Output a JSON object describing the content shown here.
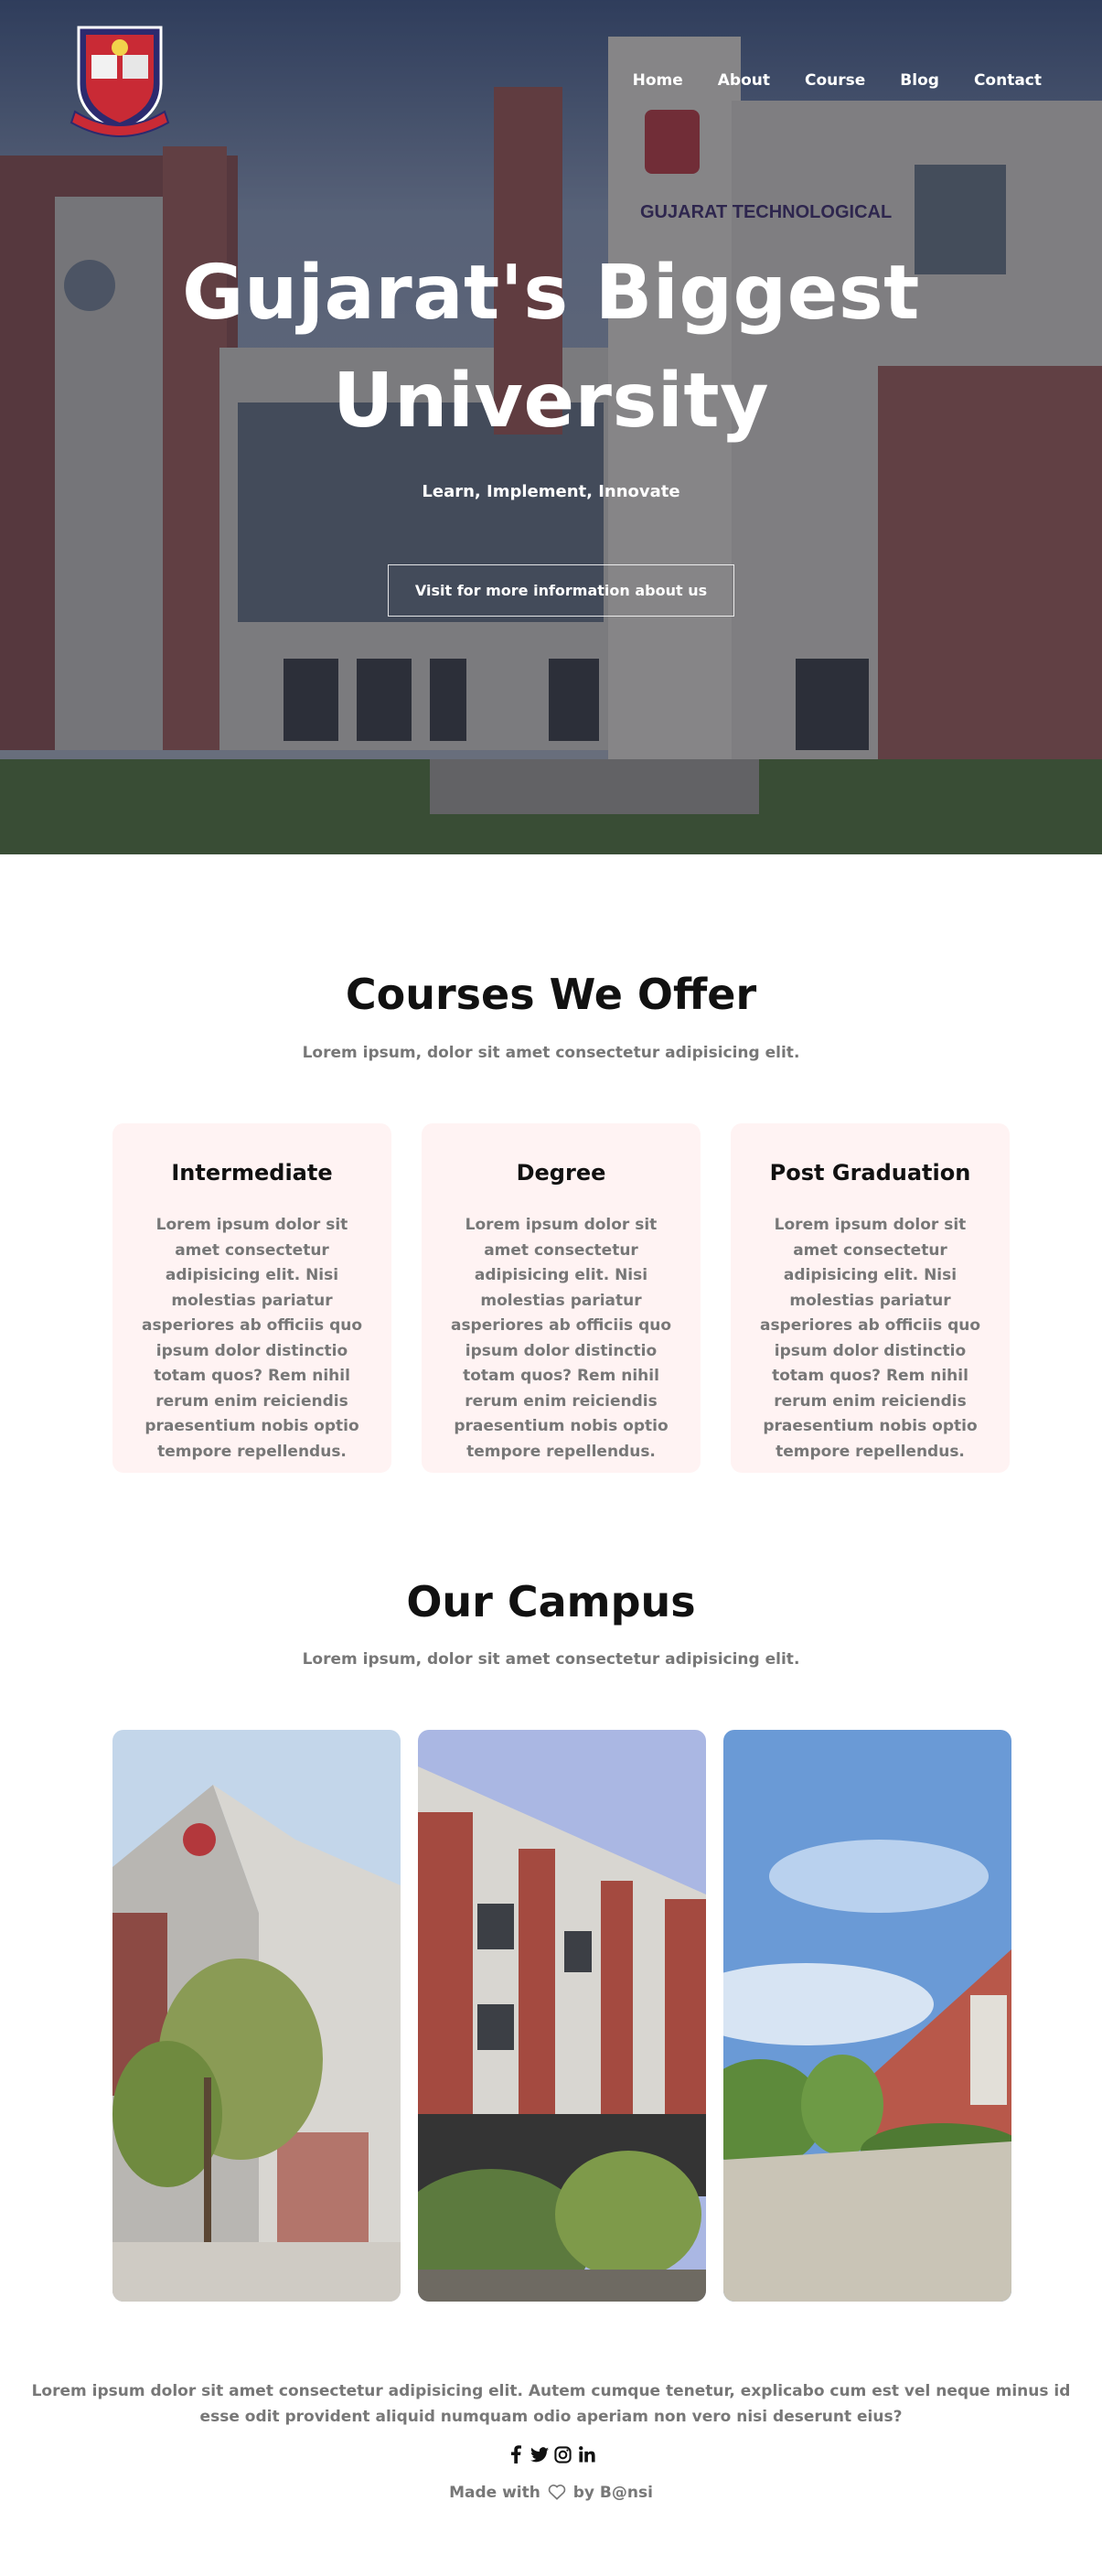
{
  "nav": {
    "items": [
      "Home",
      "About",
      "Course",
      "Blog",
      "Contact"
    ]
  },
  "hero": {
    "title_line1": "Gujarat's Biggest",
    "title_line2": "University",
    "subtitle": "Learn, Implement, Innovate",
    "button_label": "Visit for more information about us",
    "building_sign": "GUJARAT TECHNOLOGICAL"
  },
  "courses": {
    "title": "Courses We Offer",
    "subtitle": "Lorem ipsum, dolor sit amet consectetur adipisicing elit.",
    "cards": [
      {
        "title": "Intermediate",
        "body": "Lorem ipsum dolor sit amet consectetur adipisicing elit. Nisi molestias pariatur asperiores ab officiis quo ipsum dolor distinctio totam quos? Rem nihil rerum enim reiciendis praesentium nobis optio tempore repellendus."
      },
      {
        "title": "Degree",
        "body": "Lorem ipsum dolor sit amet consectetur adipisicing elit. Nisi molestias pariatur asperiores ab officiis quo ipsum dolor distinctio totam quos? Rem nihil rerum enim reiciendis praesentium nobis optio tempore repellendus."
      },
      {
        "title": "Post Graduation",
        "body": "Lorem ipsum dolor sit amet consectetur adipisicing elit. Nisi molestias pariatur asperiores ab officiis quo ipsum dolor distinctio totam quos? Rem nihil rerum enim reiciendis praesentium nobis optio tempore repellendus."
      }
    ]
  },
  "campus": {
    "title": "Our Campus",
    "subtitle": "Lorem ipsum, dolor sit amet consectetur adipisicing elit."
  },
  "footer": {
    "text": "Lorem ipsum dolor sit amet consectetur adipisicing elit. Autem cumque tenetur, explicabo cum est vel neque minus id esse odit provident aliquid numquam odio aperiam non vero nisi deserunt eius?",
    "made_prefix": "Made with",
    "made_suffix": "by B@nsi",
    "social_icons": [
      "facebook-icon",
      "twitter-icon",
      "instagram-icon",
      "linkedin-icon"
    ]
  },
  "colors": {
    "card_bg": "#fff3f3",
    "muted_text": "#777777",
    "heading_text": "#111111"
  }
}
